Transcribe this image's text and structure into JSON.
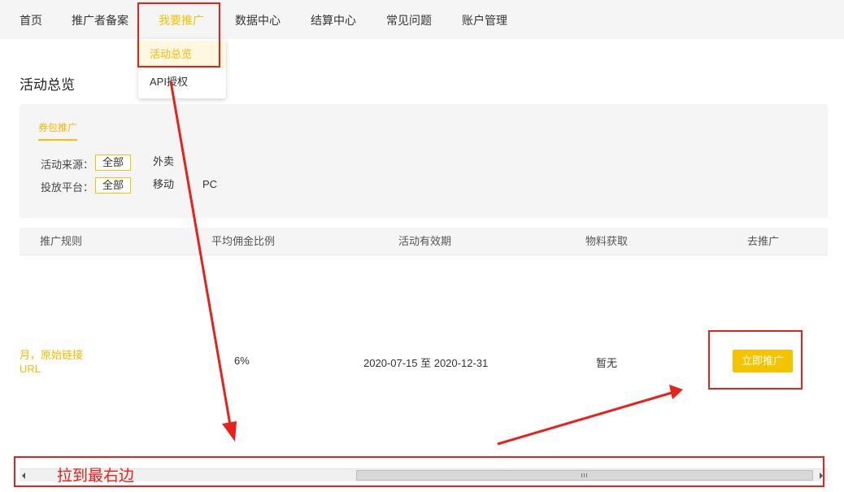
{
  "nav": {
    "items": [
      "首页",
      "推广者备案",
      "我要推广",
      "数据中心",
      "结算中心",
      "常见问题",
      "账户管理"
    ],
    "active_index": 2
  },
  "dropdown": {
    "items": [
      "活动总览",
      "API授权"
    ],
    "selected_index": 0
  },
  "page_title": "活动总览",
  "filters": {
    "tab_label": "券包推广",
    "source": {
      "label": "活动来源：",
      "options": [
        "全部",
        "外卖"
      ],
      "selected": "全部"
    },
    "platform": {
      "label": "投放平台：",
      "options": [
        "全部",
        "移动",
        "PC"
      ],
      "selected": "全部"
    }
  },
  "table": {
    "columns": [
      "推广规则",
      "平均佣金比例",
      "活动有效期",
      "物料获取",
      "去推广"
    ],
    "rows": [
      {
        "rule_line1": "月，原始链接",
        "rule_line2": "URL",
        "commission": "6%",
        "validity": "2020-07-15 至 2020-12-31",
        "material": "暂无",
        "action": "立即推广"
      }
    ]
  },
  "annotation": {
    "text": "拉到最右边",
    "color": "#e8211a"
  },
  "colors": {
    "accent": "#f5c400",
    "panel_bg": "#f5f5f5"
  },
  "scrollbar": {
    "horizontal_position": "right"
  }
}
